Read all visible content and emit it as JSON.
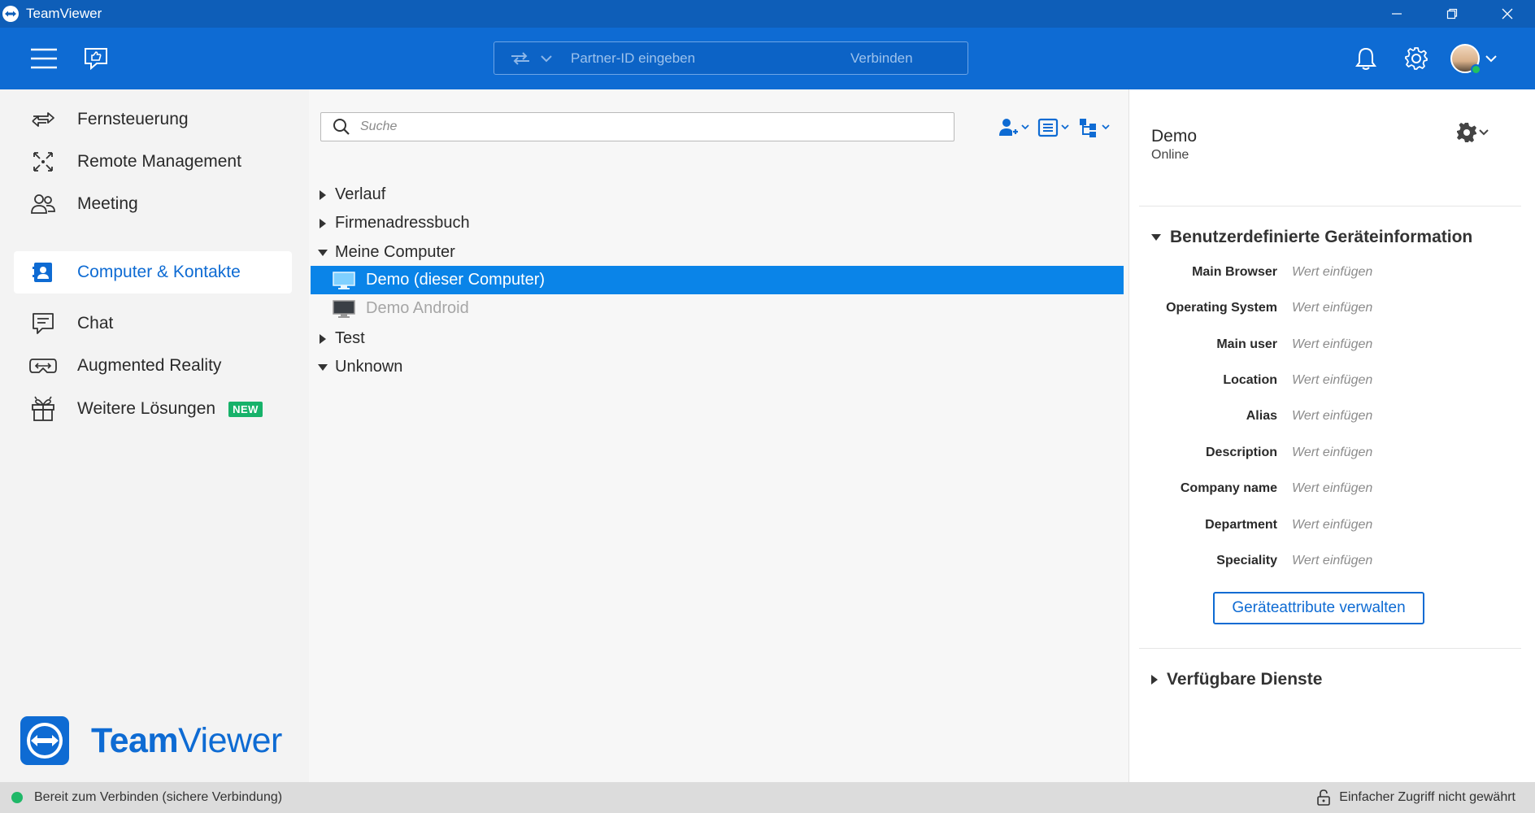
{
  "titlebar": {
    "app_name": "TeamViewer",
    "controls": [
      "minimize-icon",
      "restore-icon",
      "close-icon"
    ]
  },
  "header": {
    "partner_id_placeholder": "Partner-ID eingeben",
    "connect_label": "Verbinden",
    "icons": [
      "hamburger-menu-icon",
      "feedback-icon",
      "bell-icon",
      "gear-icon",
      "avatar"
    ]
  },
  "sidebar": {
    "items": [
      {
        "label": "Fernsteuerung",
        "icon": "remote-control-icon"
      },
      {
        "label": "Remote Management",
        "icon": "remote-management-icon"
      },
      {
        "label": "Meeting",
        "icon": "meeting-icon"
      },
      {
        "label": "Computer & Kontakte",
        "icon": "contacts-icon",
        "active": true
      },
      {
        "label": "Chat",
        "icon": "chat-icon"
      },
      {
        "label": "Augmented Reality",
        "icon": "augmented-reality-icon"
      },
      {
        "label": "Weitere Lösungen",
        "icon": "gift-icon",
        "badge": "NEW"
      }
    ],
    "brand": {
      "bold": "Team",
      "regular": "Viewer"
    }
  },
  "main": {
    "search_placeholder": "Suche",
    "tree": [
      {
        "label": "Verlauf",
        "expanded": false
      },
      {
        "label": "Firmenadressbuch",
        "expanded": false
      },
      {
        "label": "Meine Computer",
        "expanded": true
      },
      {
        "label": "Demo (dieser Computer)",
        "child": true,
        "selected": true
      },
      {
        "label": "Demo Android",
        "child": true,
        "offline": true
      },
      {
        "label": "Test",
        "expanded": false
      },
      {
        "label": "Unknown",
        "expanded": true
      }
    ]
  },
  "detail": {
    "name": "Demo",
    "status": "Online",
    "section_title": "Benutzerdefinierte Geräteinformation",
    "attributes": [
      {
        "label": "Main Browser",
        "value": "Wert einfügen"
      },
      {
        "label": "Operating System",
        "value": "Wert einfügen"
      },
      {
        "label": "Main user",
        "value": "Wert einfügen"
      },
      {
        "label": "Location",
        "value": "Wert einfügen"
      },
      {
        "label": "Alias",
        "value": "Wert einfügen"
      },
      {
        "label": "Description",
        "value": "Wert einfügen"
      },
      {
        "label": "Company name",
        "value": "Wert einfügen"
      },
      {
        "label": "Department",
        "value": "Wert einfügen"
      },
      {
        "label": "Speciality",
        "value": "Wert einfügen"
      }
    ],
    "manage_button": "Geräteattribute verwalten",
    "services_title": "Verfügbare Dienste"
  },
  "statusbar": {
    "left": "Bereit zum Verbinden (sichere Verbindung)",
    "right": "Einfacher Zugriff nicht gewährt"
  },
  "colors": {
    "header_blue": "#0e6bd3",
    "titlebar_blue": "#0e5eb8",
    "selected_row": "#0a84e8",
    "online_green": "#1fb868"
  }
}
